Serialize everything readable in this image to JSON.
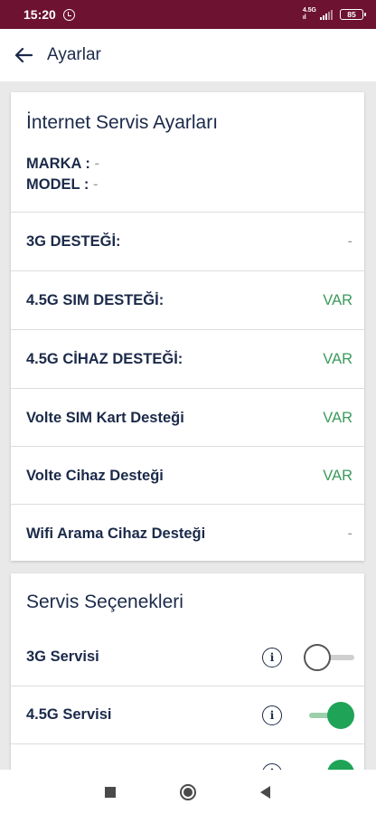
{
  "status_bar": {
    "time": "15:20",
    "network_top": "4.5G",
    "network_bottom": "ıl",
    "battery": "85"
  },
  "app_bar": {
    "title": "Ayarlar"
  },
  "internet_card": {
    "title": "İnternet Servis Ayarları",
    "brand_label": "MARKA :",
    "brand_value": "-",
    "model_label": "MODEL :",
    "model_value": "-",
    "rows": [
      {
        "label": "3G DESTEĞİ:",
        "value": "-"
      },
      {
        "label": "4.5G SIM DESTEĞİ:",
        "value": "VAR"
      },
      {
        "label": "4.5G CİHAZ DESTEĞİ:",
        "value": "VAR"
      },
      {
        "label": "Volte SIM Kart Desteği",
        "value": "VAR"
      },
      {
        "label": "Volte Cihaz Desteği",
        "value": "VAR"
      },
      {
        "label": "Wifi Arama Cihaz Desteği",
        "value": "-"
      }
    ]
  },
  "services_card": {
    "title": "Servis Seçenekleri",
    "items": [
      {
        "label": "3G Servisi",
        "enabled": false
      },
      {
        "label": "4.5G Servisi",
        "enabled": true
      },
      {
        "label": "",
        "enabled": true
      }
    ]
  },
  "colors": {
    "status_bar": "#6d1230",
    "value_green": "#3a9a5c",
    "toggle_on": "#1fa356",
    "text_navy": "#1b2a4a"
  },
  "icons": [
    "alarm-icon",
    "signal-icon",
    "battery-icon",
    "back-arrow-icon",
    "info-icon",
    "recents-square-icon",
    "home-circle-icon",
    "back-triangle-icon"
  ]
}
